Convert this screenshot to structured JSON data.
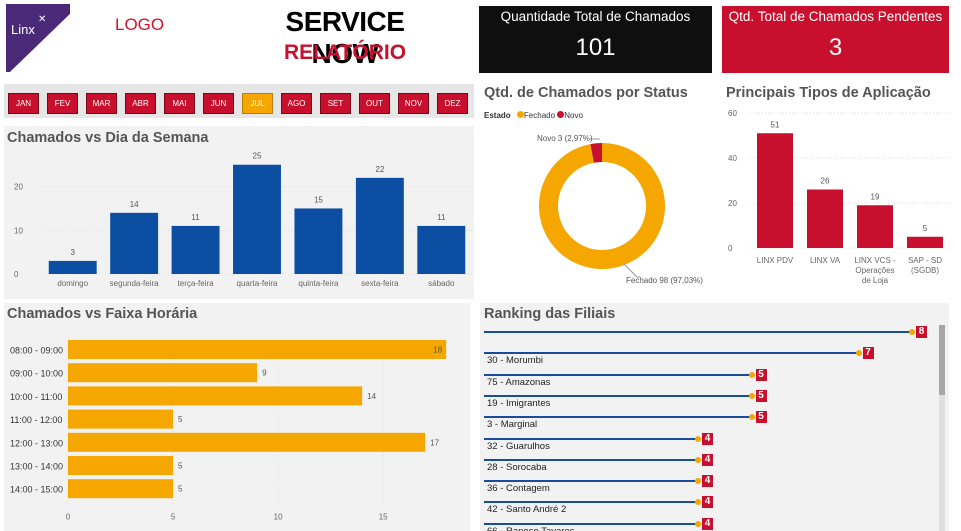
{
  "header": {
    "logo_wordmark": "Linx",
    "logo_placeholder": "LOGO",
    "title": "SERVICE NOW",
    "subtitle": "RELATÓRIO"
  },
  "kpis": [
    {
      "label": "Quantidade Total de Chamados",
      "value": "101"
    },
    {
      "label": "Qtd. Total de Chamados Pendentes",
      "value": "3"
    }
  ],
  "months": {
    "items": [
      "JAN",
      "FEV",
      "MAR",
      "ABR",
      "MAI",
      "JUN",
      "JUL",
      "AGO",
      "SET",
      "OUT",
      "NOV",
      "DEZ"
    ],
    "selected": "JUL"
  },
  "colors": {
    "primary_red": "#c8102e",
    "accent_orange": "#f5a700",
    "bar_blue": "#0b4ea2",
    "rank_line": "#1a4c99"
  },
  "status_chart": {
    "title": "Qtd. de Chamados por Status",
    "legend_title": "Estado"
  },
  "app_chart": {
    "title": "Principais Tipos de Aplicação"
  },
  "week_chart": {
    "title": "Chamados vs Dia da Semana"
  },
  "hour_chart": {
    "title": "Chamados vs Faixa Horária"
  },
  "ranking": {
    "title": "Ranking das Filiais",
    "rows": [
      {
        "name": "",
        "value": 8
      },
      {
        "name": "30 - Morumbi",
        "value": 7
      },
      {
        "name": "75 - Amazonas",
        "value": 5
      },
      {
        "name": "19 - Imigrantes",
        "value": 5
      },
      {
        "name": "3 - Marginal",
        "value": 5
      },
      {
        "name": "32 - Guarulhos",
        "value": 4
      },
      {
        "name": "28 - Sorocaba",
        "value": 4
      },
      {
        "name": "36 - Contagem",
        "value": 4
      },
      {
        "name": "42 - Santo André 2",
        "value": 4
      },
      {
        "name": "66 - Raposo Tavares",
        "value": 4
      }
    ]
  },
  "chart_data": [
    {
      "type": "bar",
      "title": "Chamados vs Dia da Semana",
      "categories": [
        "domingo",
        "segunda-feira",
        "terça-feira",
        "quarta-feira",
        "quinta-feira",
        "sexta-feira",
        "sábado"
      ],
      "values": [
        3,
        14,
        11,
        25,
        15,
        22,
        11
      ],
      "ylim": [
        0,
        27
      ],
      "yticks": [
        0,
        10,
        20
      ],
      "grid": true
    },
    {
      "type": "pie",
      "title": "Qtd. de Chamados por Status",
      "legend_title": "Estado",
      "legend_position": "top-left",
      "slices": [
        {
          "name": "Fechado",
          "value": 98,
          "label": "Fechado 98 (97,03%)",
          "color": "#f5a700"
        },
        {
          "name": "Novo",
          "value": 3,
          "label": "Novo 3 (2,97%)",
          "color": "#c8102e"
        }
      ]
    },
    {
      "type": "bar",
      "title": "Principais Tipos de Aplicação",
      "categories": [
        [
          "LINX PDV"
        ],
        [
          "LINX VA"
        ],
        [
          "LINX VCS -",
          "Operações",
          "de Loja"
        ],
        [
          "SAP - SD",
          "(SGDB)"
        ]
      ],
      "values": [
        51,
        26,
        19,
        5
      ],
      "ylim": [
        0,
        60
      ],
      "yticks": [
        0,
        20,
        40,
        60
      ],
      "grid": true
    },
    {
      "type": "bar",
      "orientation": "horizontal",
      "title": "Chamados vs Faixa Horária",
      "categories": [
        "08:00 - 09:00",
        "09:00 - 10:00",
        "10:00 - 11:00",
        "11:00 - 12:00",
        "12:00 - 13:00",
        "13:00 - 14:00",
        "14:00 - 15:00"
      ],
      "values": [
        18,
        9,
        14,
        5,
        17,
        5,
        5
      ],
      "xlim": [
        0,
        18
      ],
      "xticks": [
        0,
        5,
        10,
        15
      ],
      "grid": true
    }
  ]
}
